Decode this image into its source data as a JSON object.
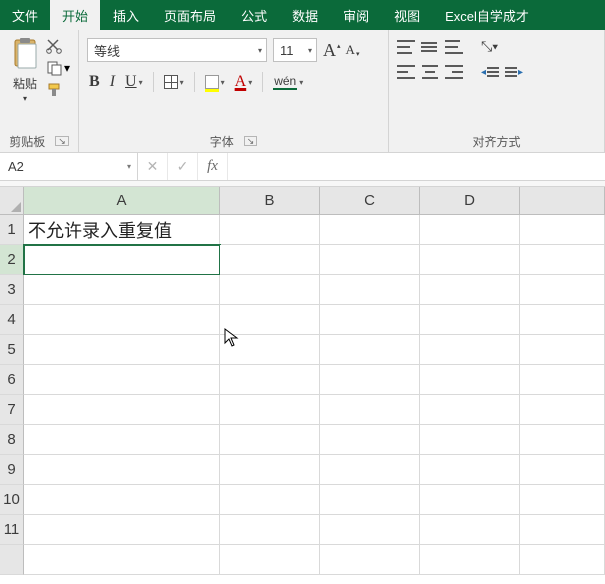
{
  "tabs": {
    "file": "文件",
    "home": "开始",
    "insert": "插入",
    "layout": "页面布局",
    "formulas": "公式",
    "data": "数据",
    "review": "审阅",
    "view": "视图",
    "extra": "Excel自学成才"
  },
  "ribbon": {
    "clipboard": {
      "paste": "粘贴",
      "label": "剪贴板"
    },
    "font": {
      "name": "等线",
      "size": "11",
      "grow": "A",
      "shrink": "A",
      "bold": "B",
      "italic": "I",
      "underline": "U",
      "font_color_letter": "A",
      "phonetic": "wén",
      "label": "字体"
    },
    "align": {
      "label": "对齐方式"
    }
  },
  "namebox": "A2",
  "fx_label": "fx",
  "columns": [
    "A",
    "B",
    "C",
    "D",
    ""
  ],
  "rows": [
    "1",
    "2",
    "3",
    "4",
    "5",
    "6",
    "7",
    "8",
    "9",
    "10",
    "11",
    ""
  ],
  "cells": {
    "A1": "不允许录入重复值"
  },
  "active_cell": "A2",
  "colors": {
    "ribbon_green": "#0b6a3a",
    "selection_green": "#217346"
  }
}
